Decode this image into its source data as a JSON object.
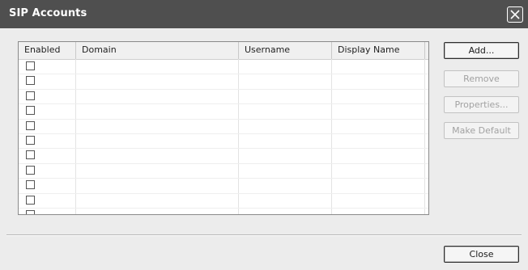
{
  "window": {
    "title": "SIP Accounts"
  },
  "table": {
    "columns": [
      "Enabled",
      "Domain",
      "Username",
      "Display Name"
    ],
    "rows": [
      {
        "enabled": false,
        "domain": "",
        "username": "",
        "display_name": ""
      },
      {
        "enabled": false,
        "domain": "",
        "username": "",
        "display_name": ""
      },
      {
        "enabled": false,
        "domain": "",
        "username": "",
        "display_name": ""
      },
      {
        "enabled": false,
        "domain": "",
        "username": "",
        "display_name": ""
      },
      {
        "enabled": false,
        "domain": "",
        "username": "",
        "display_name": ""
      },
      {
        "enabled": false,
        "domain": "",
        "username": "",
        "display_name": ""
      },
      {
        "enabled": false,
        "domain": "",
        "username": "",
        "display_name": ""
      },
      {
        "enabled": false,
        "domain": "",
        "username": "",
        "display_name": ""
      },
      {
        "enabled": false,
        "domain": "",
        "username": "",
        "display_name": ""
      },
      {
        "enabled": false,
        "domain": "",
        "username": "",
        "display_name": ""
      },
      {
        "enabled": false,
        "domain": "",
        "username": "",
        "display_name": ""
      }
    ]
  },
  "buttons": {
    "add": "Add...",
    "remove": "Remove",
    "properties": "Properties...",
    "make_default": "Make Default",
    "close": "Close"
  },
  "icons": {
    "close": "close-icon"
  },
  "colors": {
    "titlebar": "#4f4f4f",
    "background": "#ececec"
  }
}
